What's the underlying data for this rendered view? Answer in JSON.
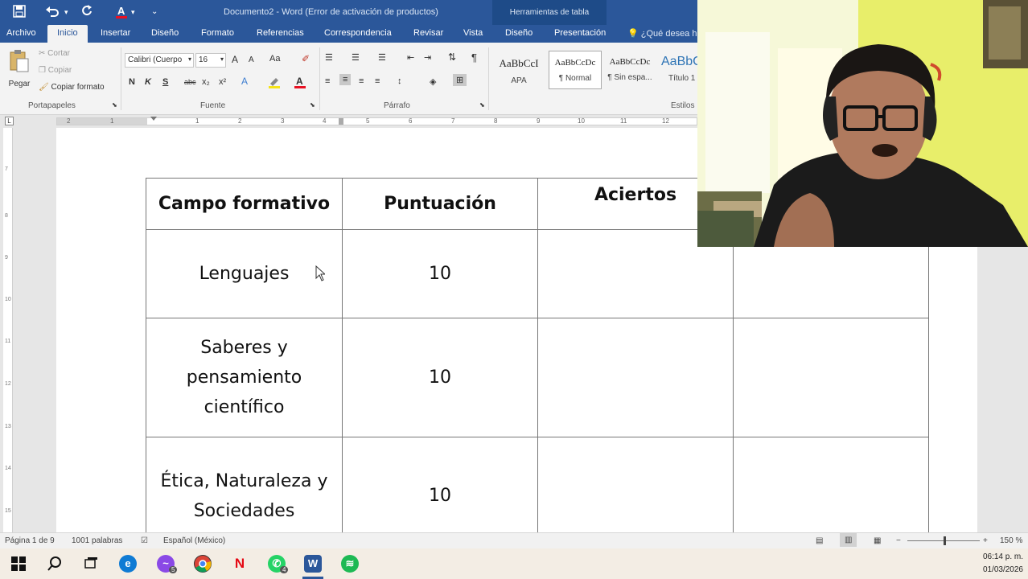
{
  "quick_access": {
    "save_icon": "save-icon",
    "undo_icon": "undo-icon",
    "redo_icon": "redo-icon",
    "font_color_icon": "font-color-icon",
    "customize_icon": "customize-icon"
  },
  "window": {
    "title": "Documento2 - Word (Error de activación de productos)",
    "context_group": "Herramientas de tabla"
  },
  "tabs": [
    "Archivo",
    "Inicio",
    "Insertar",
    "Diseño",
    "Formato",
    "Referencias",
    "Correspondencia",
    "Revisar",
    "Vista",
    "Diseño",
    "Presentación"
  ],
  "tell_me": "¿Qué desea ha",
  "ribbon": {
    "clipboard": {
      "paste": "Pegar",
      "cut": "Cortar",
      "copy": "Copiar",
      "format_painter": "Copiar formato",
      "label": "Portapapeles"
    },
    "font": {
      "name": "Calibri (Cuerpo",
      "size": "16",
      "label": "Fuente",
      "bold": "N",
      "italic": "K",
      "underline": "S",
      "strike": "abc",
      "subscript": "x₂",
      "superscript": "x²",
      "change_case": "Aa",
      "grow": "A",
      "shrink": "A"
    },
    "paragraph": {
      "label": "Párrafo",
      "pilcrow": "¶"
    },
    "styles": {
      "label": "Estilos",
      "items": [
        {
          "sample": "AaBbCcI",
          "name": "APA"
        },
        {
          "sample": "AaBbCcDc",
          "name": "¶ Normal"
        },
        {
          "sample": "AaBbCcDc",
          "name": "¶ Sin espa..."
        },
        {
          "sample": "AaBbC",
          "name": "Título 1"
        }
      ]
    }
  },
  "ruler": {
    "numbers": [
      "2",
      "1",
      "1",
      "2",
      "3",
      "4",
      "5",
      "6",
      "7",
      "8",
      "9",
      "10",
      "11",
      "12"
    ],
    "v_numbers": [
      "7",
      "8",
      "9",
      "10",
      "11",
      "12",
      "13",
      "14",
      "15"
    ]
  },
  "table": {
    "headers": [
      "Campo formativo",
      "Puntuación",
      "Aciertos"
    ],
    "rows": [
      {
        "campo": "Lenguajes",
        "puntuacion": "10",
        "aciertos": ""
      },
      {
        "campo": "Saberes y pensamiento científico",
        "puntuacion": "10",
        "aciertos": ""
      },
      {
        "campo": "Ética, Naturaleza y Sociedades",
        "puntuacion": "10",
        "aciertos": ""
      }
    ]
  },
  "status": {
    "page": "Página 1 de 9",
    "words": "1001 palabras",
    "language": "Español (México)",
    "zoom": "150 %",
    "zoom_percent": 150
  },
  "taskbar": {
    "apps": [
      "windows-start",
      "search",
      "task-view",
      "edge",
      "messenger",
      "chrome",
      "netflix",
      "whatsapp",
      "word",
      "spotify"
    ],
    "messenger_badge": "5",
    "whatsapp_badge": "4",
    "time": "06:14 p. m.",
    "date": "01/03/2026"
  },
  "colors": {
    "word_blue": "#2b579a",
    "ribbon_bg": "#f3f3f3",
    "doc_bg": "#e6e6e6"
  }
}
